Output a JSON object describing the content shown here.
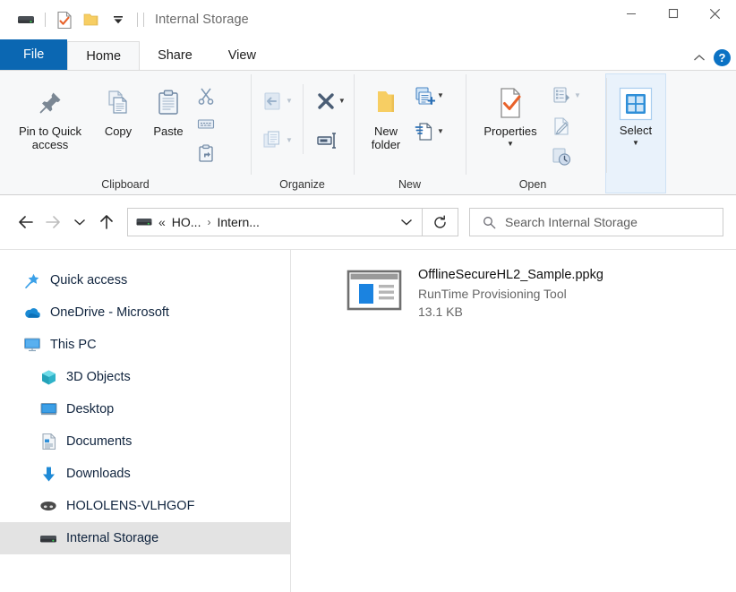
{
  "window": {
    "title": "Internal Storage",
    "controls": {
      "minimize": "minimize-icon",
      "maximize": "maximize-icon",
      "close": "close-icon"
    }
  },
  "quick_access_toolbar": {
    "items": [
      {
        "name": "drive-icon",
        "label": "Internal Storage"
      },
      {
        "name": "properties-icon",
        "label": "Properties"
      },
      {
        "name": "new-folder-icon",
        "label": "New folder"
      },
      {
        "name": "customize-dropdown-icon",
        "label": "Customize Quick Access Toolbar"
      }
    ]
  },
  "tabs": [
    {
      "label": "File",
      "state": "file"
    },
    {
      "label": "Home",
      "state": "active"
    },
    {
      "label": "Share",
      "state": "normal"
    },
    {
      "label": "View",
      "state": "normal"
    }
  ],
  "ribbon_tools": {
    "collapse_label": "Collapse the Ribbon",
    "help_label": "?"
  },
  "ribbon": {
    "groups": [
      {
        "label": "Clipboard",
        "big": [
          {
            "label": "Pin to Quick\naccess",
            "line1": "Pin to Quick",
            "line2": "access",
            "icon": "pin-icon",
            "enabled": true
          },
          {
            "label": "Copy",
            "line1": "Copy",
            "line2": "",
            "icon": "copy-icon",
            "enabled": true
          },
          {
            "label": "Paste",
            "line1": "Paste",
            "line2": "",
            "icon": "paste-icon",
            "enabled": true
          }
        ],
        "small": [
          {
            "label": "Cut",
            "icon": "scissors-icon",
            "enabled": true
          },
          {
            "label": "Copy path",
            "icon": "copy-path-icon",
            "enabled": true
          },
          {
            "label": "Paste shortcut",
            "icon": "paste-shortcut-icon",
            "enabled": true
          }
        ]
      },
      {
        "label": "Organize",
        "small_left": [
          {
            "label": "Move to",
            "icon": "move-to-icon",
            "enabled": false
          },
          {
            "label": "Copy to",
            "icon": "copy-to-icon",
            "enabled": false
          }
        ],
        "small_right": [
          {
            "label": "Delete",
            "icon": "delete-icon",
            "enabled": true
          },
          {
            "label": "Rename",
            "icon": "rename-icon",
            "enabled": true
          }
        ]
      },
      {
        "label": "New",
        "big": [
          {
            "label": "New folder",
            "line1": "New",
            "line2": "folder",
            "icon": "new-folder-icon",
            "enabled": true
          }
        ],
        "small": [
          {
            "label": "New item",
            "icon": "new-item-icon",
            "enabled": true
          },
          {
            "label": "Easy access",
            "icon": "easy-access-icon",
            "enabled": true
          }
        ]
      },
      {
        "label": "Open",
        "big": [
          {
            "label": "Properties",
            "line1": "Properties",
            "line2": "",
            "icon": "properties-icon",
            "enabled": true
          }
        ],
        "small": [
          {
            "label": "Open",
            "icon": "open-icon",
            "enabled": false
          },
          {
            "label": "Edit",
            "icon": "edit-icon",
            "enabled": false
          },
          {
            "label": "History",
            "icon": "history-icon",
            "enabled": false
          }
        ]
      },
      {
        "label": "",
        "highlighted": true,
        "big": [
          {
            "label": "Select",
            "line1": "Select",
            "line2": "",
            "icon": "select-grid-icon",
            "enabled": true
          }
        ]
      }
    ]
  },
  "address_bar": {
    "back": "back-arrow-icon",
    "forward": "forward-arrow-icon",
    "recent": "recent-locations-icon",
    "up": "up-arrow-icon",
    "breadcrumb_icon": "drive-icon",
    "breadcrumb_overflow": "«",
    "breadcrumbs": [
      "HO...",
      "Intern..."
    ],
    "separator": "›",
    "dropdown": "chevron-down-icon",
    "refresh": "refresh-icon"
  },
  "search": {
    "icon": "search-icon",
    "placeholder": "Search Internal Storage",
    "value": ""
  },
  "nav_pane": {
    "items": [
      {
        "label": "Quick access",
        "icon": "star-pin-icon",
        "indent": false,
        "selected": false
      },
      {
        "label": "OneDrive - Microsoft",
        "icon": "onedrive-cloud-icon",
        "indent": false,
        "selected": false
      },
      {
        "label": "This PC",
        "icon": "monitor-icon",
        "indent": false,
        "selected": false
      },
      {
        "label": "3D Objects",
        "icon": "cube-icon",
        "indent": true,
        "selected": false
      },
      {
        "label": "Desktop",
        "icon": "desktop-icon",
        "indent": true,
        "selected": false
      },
      {
        "label": "Documents",
        "icon": "documents-icon",
        "indent": true,
        "selected": false
      },
      {
        "label": "Downloads",
        "icon": "download-arrow-icon",
        "indent": true,
        "selected": false
      },
      {
        "label": "HOLOLENS-VLHGOF",
        "icon": "hololens-icon",
        "indent": true,
        "selected": false
      },
      {
        "label": "Internal Storage",
        "icon": "drive-icon",
        "indent": true,
        "selected": true
      }
    ]
  },
  "file_list": {
    "items": [
      {
        "name": "OfflineSecureHL2_Sample.ppkg",
        "type": "RunTime Provisioning Tool",
        "size": "13.1 KB",
        "icon": "provisioning-package-icon"
      }
    ]
  },
  "colors": {
    "accent_blue": "#0b67b2",
    "ribbon_bg": "#f7f8f9",
    "selection_grey": "#e3e3e3",
    "select_group_bg": "#e9f2fb",
    "folder_yellow": "#f7ce63",
    "orange_check": "#e8622a",
    "file_blue": "#1b83e0"
  }
}
